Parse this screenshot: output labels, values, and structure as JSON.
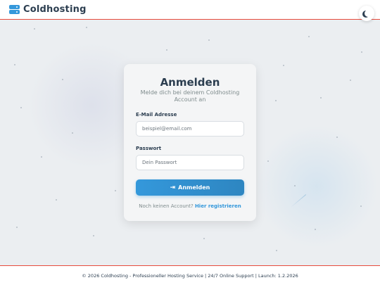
{
  "header": {
    "brand": "Coldhosting",
    "logo_icon": "server-icon",
    "theme_icon": "moon-icon"
  },
  "login": {
    "title": "Anmelden",
    "subtitle": "Melde dich bei deinem Coldhosting Account an",
    "email_label": "E-Mail Adresse",
    "email_placeholder": "beispiel@email.com",
    "email_value": "",
    "password_label": "Passwort",
    "password_placeholder": "Dein Passwort",
    "password_value": "",
    "button_label": "Anmelden",
    "button_icon": "sign-in-icon",
    "register_prompt": "Noch keinen Account?",
    "register_link": "Hier registrieren"
  },
  "footer": {
    "text": "© 2026 Coldhosting - Professioneller Hosting Service | 24/7 Online Support | Launch: 1.2.2026"
  },
  "colors": {
    "accent": "#3498db",
    "border_accent": "#e74c3c",
    "text": "#2c3e50"
  }
}
